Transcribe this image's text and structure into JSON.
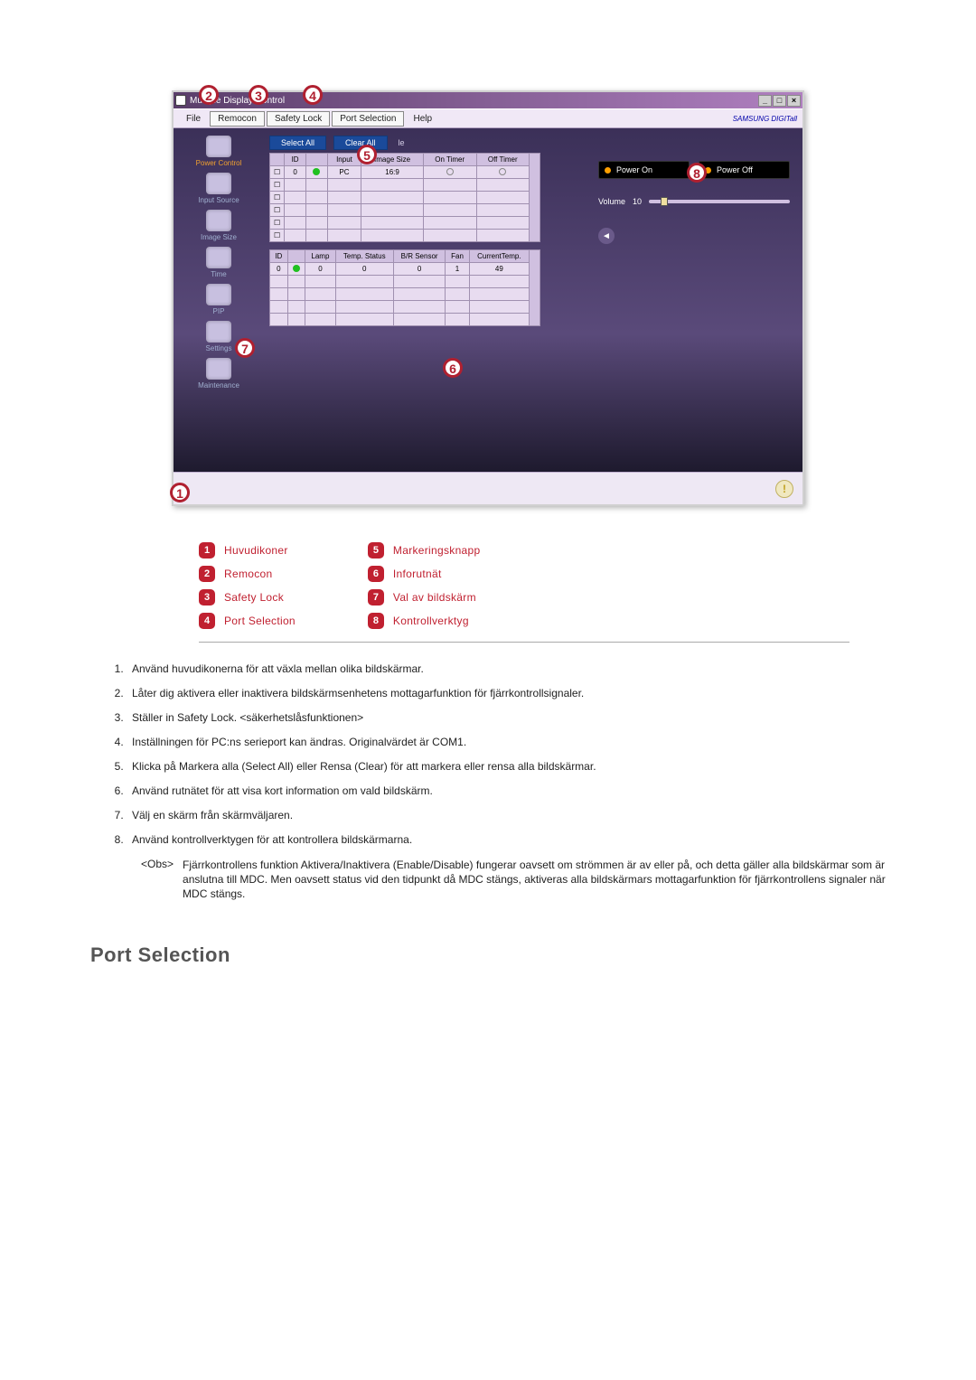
{
  "app": {
    "title": "Multiple Display Control",
    "menu": {
      "file": "File",
      "remocon": "Remocon",
      "safety_lock": "Safety Lock",
      "port_selection": "Port Selection",
      "help": "Help"
    },
    "brand": "SAMSUNG DIGITall"
  },
  "sidebar": {
    "items": [
      {
        "label": "Power Control"
      },
      {
        "label": "Input Source"
      },
      {
        "label": "Image Size"
      },
      {
        "label": "Time"
      },
      {
        "label": "PIP"
      },
      {
        "label": "Settings"
      },
      {
        "label": "Maintenance"
      }
    ]
  },
  "toolbar": {
    "select_all": "Select All",
    "clear_all": "Clear All",
    "title_suffix": "le"
  },
  "table_upper": {
    "headers": [
      "",
      "ID",
      "",
      "Input",
      "Image Size",
      "On Timer",
      "Off Timer"
    ],
    "row": {
      "id": "0",
      "input": "PC",
      "size": "16:9"
    }
  },
  "table_lower": {
    "headers": [
      "ID",
      "",
      "Lamp",
      "Temp. Status",
      "B/R Sensor",
      "Fan",
      "CurrentTemp."
    ],
    "row": {
      "id": "0",
      "lamp": "0",
      "temp": "0",
      "br": "0",
      "fan": "1",
      "ct": "49"
    }
  },
  "control": {
    "power_on": "Power On",
    "power_off": "Power Off",
    "volume_label": "Volume",
    "volume_value": "10"
  },
  "legend": {
    "left": [
      {
        "n": "1",
        "t": "Huvudikoner"
      },
      {
        "n": "2",
        "t": "Remocon"
      },
      {
        "n": "3",
        "t": "Safety Lock"
      },
      {
        "n": "4",
        "t": "Port Selection"
      }
    ],
    "right": [
      {
        "n": "5",
        "t": "Markeringsknapp"
      },
      {
        "n": "6",
        "t": "Inforutnät"
      },
      {
        "n": "7",
        "t": "Val av bildskärm"
      },
      {
        "n": "8",
        "t": "Kontrollverktyg"
      }
    ]
  },
  "desc": [
    "Använd huvudikonerna för att växla mellan olika bildskärmar.",
    "Låter dig aktivera eller inaktivera bildskärmsenhetens mottagarfunktion för fjärrkontrollsignaler.",
    "Ställer in Safety Lock. <säkerhetslåsfunktionen>",
    "Inställningen för PC:ns serieport kan ändras. Originalvärdet är COM1.",
    "Klicka på Markera alla (Select All) eller Rensa (Clear) för att markera eller rensa alla bildskärmar.",
    "Använd rutnätet för att visa kort information om vald bildskärm.",
    "Välj en skärm från skärmväljaren.",
    "Använd kontrollverktygen för att kontrollera bildskärmarna."
  ],
  "note": {
    "label": "<Obs>",
    "text": "Fjärrkontrollens funktion Aktivera/Inaktivera (Enable/Disable) fungerar oavsett om strömmen är av eller på, och detta gäller alla bildskärmar som är anslutna till MDC. Men oavsett status vid den tidpunkt då MDC stängs, aktiveras alla bildskärmars mottagarfunktion för fjärrkontrollens signaler när MDC stängs."
  },
  "section_heading": "Port Selection",
  "callouts": {
    "1": "1",
    "2": "2",
    "3": "3",
    "4": "4",
    "5": "5",
    "6": "6",
    "7": "7",
    "8": "8"
  }
}
